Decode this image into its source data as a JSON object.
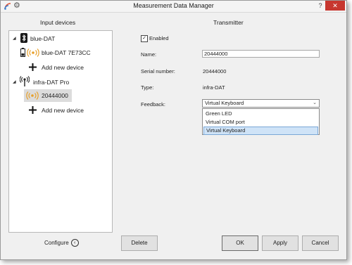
{
  "window": {
    "title": "Measurement Data Manager",
    "help_glyph": "?",
    "close_glyph": "✕"
  },
  "left": {
    "header": "Input devices",
    "tree": [
      {
        "label": "blue-DAT"
      },
      {
        "label": "blue-DAT 7E73CC"
      },
      {
        "label": "Add new device"
      },
      {
        "label": "infra-DAT Pro"
      },
      {
        "label": "20444000"
      },
      {
        "label": "Add new device"
      }
    ],
    "configure_label": "Configure"
  },
  "right": {
    "header": "Transmitter",
    "enabled_label": "Enabled",
    "enabled_checked": true,
    "name_label": "Name:",
    "name_value": "20444000",
    "serial_label": "Serial number:",
    "serial_value": "20444000",
    "type_label": "Type:",
    "type_value": "infra-DAT",
    "feedback_label": "Feedback:",
    "feedback_value": "Virtual Keyboard",
    "feedback_options": [
      "Green LED",
      "Virtual COM port",
      "Virtual Keyboard"
    ]
  },
  "buttons": {
    "delete": "Delete",
    "ok": "OK",
    "apply": "Apply",
    "cancel": "Cancel"
  },
  "colors": {
    "close_red": "#c7372f",
    "signal_orange": "#e8a02a",
    "selection_blue": "#cfe3f7"
  }
}
